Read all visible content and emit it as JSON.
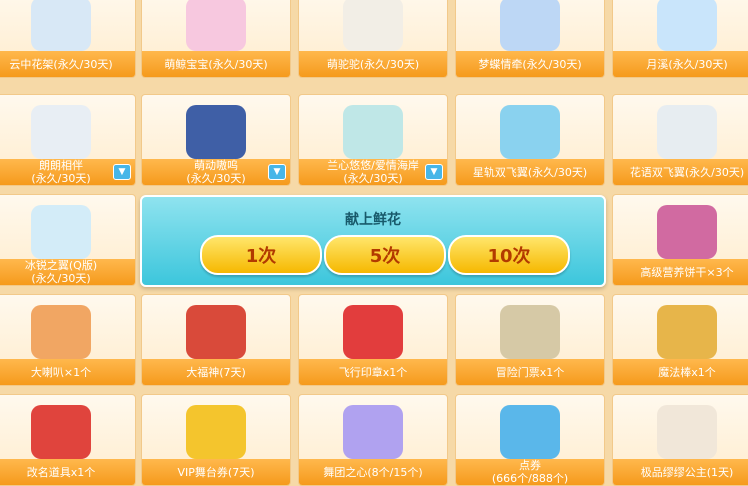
{
  "items": [
    {
      "label": "云中花架(永久/30天)",
      "icon": "flower-arch-icon",
      "color": "#d8e8f6"
    },
    {
      "label": "萌鲸宝宝(永久/30天)",
      "icon": "baby-whale-icon",
      "color": "#f7c8df"
    },
    {
      "label": "萌驼驼(永久/30天)",
      "icon": "alpaca-icon",
      "color": "#f2eee6"
    },
    {
      "label": "梦蝶情牵(永久/30天)",
      "icon": "butterfly-icon",
      "color": "#bdd7f5"
    },
    {
      "label": "月溪(永久/30天)",
      "icon": "winged-horse-icon",
      "color": "#c9e5fb"
    },
    {
      "label": "朗朗相伴\n(永久/30天)",
      "icon": "outfit-icon",
      "color": "#e8eef4"
    },
    {
      "label": "萌动嗷呜\n(永久/30天)",
      "icon": "outfit-pair-icon",
      "color": "#3f5fa6"
    },
    {
      "label": "兰心悠悠/爱情海岸\n(永久/30天)",
      "icon": "outfit-swim-icon",
      "color": "#bfe7e7"
    },
    {
      "label": "星轨双飞翼(永久/30天)",
      "icon": "wings-icon",
      "color": "#8ad2ef"
    },
    {
      "label": "花语双飞翼(永久/30天)",
      "icon": "wings-icon",
      "color": "#e7edf1"
    },
    {
      "label": "冰锐之翼(Q版)\n(永久/30天)",
      "icon": "ice-wings-icon",
      "color": "#d3ecf8"
    },
    {
      "label": "高级营养饼干×3个",
      "icon": "ticket-icon",
      "color": "#d16aa1"
    },
    {
      "label": "大喇叭×1个",
      "icon": "loudspeaker-icon",
      "color": "#f1a663"
    },
    {
      "label": "大福神(7天)",
      "icon": "fortune-god-icon",
      "color": "#d94a3a"
    },
    {
      "label": "飞行印章x1个",
      "icon": "seal-stamp-icon",
      "color": "#e23d3d"
    },
    {
      "label": "冒险门票x1个",
      "icon": "scroll-ticket-icon",
      "color": "#d6c9a6"
    },
    {
      "label": "魔法棒x1个",
      "icon": "magic-wand-icon",
      "color": "#e7b54a"
    },
    {
      "label": "改名道具x1个",
      "icon": "rename-card-icon",
      "color": "#e0443d"
    },
    {
      "label": "VIP舞台券(7天)",
      "icon": "vip-ticket-icon",
      "color": "#f4c52d"
    },
    {
      "label": "舞团之心(8个/15个)",
      "icon": "heart-gem-icon",
      "color": "#b0a2f0"
    },
    {
      "label": "点券\n(666个/888个)",
      "icon": "coupon-icon",
      "color": "#5ab7ea"
    },
    {
      "label": "极品缪缪公主(1天)",
      "icon": "egg-icon",
      "color": "#f1e7d9"
    }
  ],
  "panel": {
    "title": "献上鲜花",
    "buttons": [
      "1次",
      "5次",
      "10次"
    ]
  }
}
